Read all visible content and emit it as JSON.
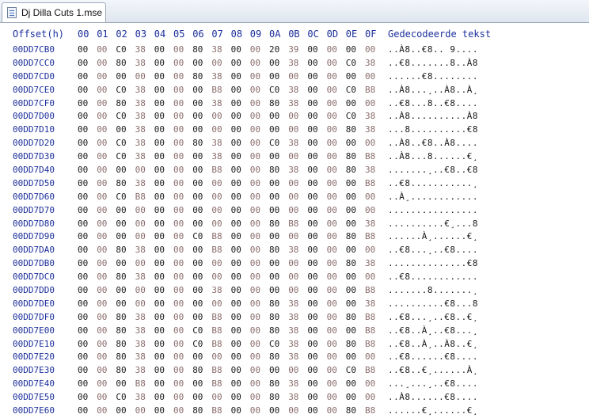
{
  "tab": {
    "title": "Dj Dilla Cuts 1.mse"
  },
  "header": {
    "offset_label": "Offset(h)",
    "columns": [
      "00",
      "01",
      "02",
      "03",
      "04",
      "05",
      "06",
      "07",
      "08",
      "09",
      "0A",
      "0B",
      "0C",
      "0D",
      "0E",
      "0F"
    ],
    "text_label": "Gedecodeerde tekst"
  },
  "rows": [
    {
      "offset": "00DD7CB0",
      "bytes": [
        "00",
        "00",
        "C0",
        "38",
        "00",
        "00",
        "80",
        "38",
        "00",
        "00",
        "20",
        "39",
        "00",
        "00",
        "00",
        "00"
      ],
      "text": "..À8..€8.. 9...."
    },
    {
      "offset": "00DD7CC0",
      "bytes": [
        "00",
        "00",
        "80",
        "38",
        "00",
        "00",
        "00",
        "00",
        "00",
        "00",
        "00",
        "38",
        "00",
        "00",
        "C0",
        "38"
      ],
      "text": "..€8.......8..À8"
    },
    {
      "offset": "00DD7CD0",
      "bytes": [
        "00",
        "00",
        "00",
        "00",
        "00",
        "00",
        "80",
        "38",
        "00",
        "00",
        "00",
        "00",
        "00",
        "00",
        "00",
        "00"
      ],
      "text": "......€8........"
    },
    {
      "offset": "00DD7CE0",
      "bytes": [
        "00",
        "00",
        "C0",
        "38",
        "00",
        "00",
        "00",
        "B8",
        "00",
        "00",
        "C0",
        "38",
        "00",
        "00",
        "C0",
        "B8"
      ],
      "text": "..À8...¸..À8..À¸"
    },
    {
      "offset": "00DD7CF0",
      "bytes": [
        "00",
        "00",
        "80",
        "38",
        "00",
        "00",
        "00",
        "38",
        "00",
        "00",
        "80",
        "38",
        "00",
        "00",
        "00",
        "00"
      ],
      "text": "..€8...8..€8...."
    },
    {
      "offset": "00DD7D00",
      "bytes": [
        "00",
        "00",
        "C0",
        "38",
        "00",
        "00",
        "00",
        "00",
        "00",
        "00",
        "00",
        "00",
        "00",
        "00",
        "C0",
        "38"
      ],
      "text": "..À8..........À8"
    },
    {
      "offset": "00DD7D10",
      "bytes": [
        "00",
        "00",
        "00",
        "38",
        "00",
        "00",
        "00",
        "00",
        "00",
        "00",
        "00",
        "00",
        "00",
        "00",
        "80",
        "38"
      ],
      "text": "...8..........€8"
    },
    {
      "offset": "00DD7D20",
      "bytes": [
        "00",
        "00",
        "C0",
        "38",
        "00",
        "00",
        "80",
        "38",
        "00",
        "00",
        "C0",
        "38",
        "00",
        "00",
        "00",
        "00"
      ],
      "text": "..À8..€8..À8...."
    },
    {
      "offset": "00DD7D30",
      "bytes": [
        "00",
        "00",
        "C0",
        "38",
        "00",
        "00",
        "00",
        "38",
        "00",
        "00",
        "00",
        "00",
        "00",
        "00",
        "80",
        "B8"
      ],
      "text": "..À8...8......€¸"
    },
    {
      "offset": "00DD7D40",
      "bytes": [
        "00",
        "00",
        "00",
        "00",
        "00",
        "00",
        "00",
        "B8",
        "00",
        "00",
        "80",
        "38",
        "00",
        "00",
        "80",
        "38"
      ],
      "text": ".......¸..€8..€8"
    },
    {
      "offset": "00DD7D50",
      "bytes": [
        "00",
        "00",
        "80",
        "38",
        "00",
        "00",
        "00",
        "00",
        "00",
        "00",
        "00",
        "00",
        "00",
        "00",
        "00",
        "B8"
      ],
      "text": "..€8...........¸"
    },
    {
      "offset": "00DD7D60",
      "bytes": [
        "00",
        "00",
        "C0",
        "B8",
        "00",
        "00",
        "00",
        "00",
        "00",
        "00",
        "00",
        "00",
        "00",
        "00",
        "00",
        "00"
      ],
      "text": "..À¸............"
    },
    {
      "offset": "00DD7D70",
      "bytes": [
        "00",
        "00",
        "00",
        "00",
        "00",
        "00",
        "00",
        "00",
        "00",
        "00",
        "00",
        "00",
        "00",
        "00",
        "00",
        "00"
      ],
      "text": "................"
    },
    {
      "offset": "00DD7D80",
      "bytes": [
        "00",
        "00",
        "00",
        "00",
        "00",
        "00",
        "00",
        "00",
        "00",
        "00",
        "80",
        "B8",
        "00",
        "00",
        "00",
        "38"
      ],
      "text": "..........€¸...8"
    },
    {
      "offset": "00DD7D90",
      "bytes": [
        "00",
        "00",
        "00",
        "00",
        "00",
        "00",
        "C0",
        "B8",
        "00",
        "00",
        "00",
        "00",
        "00",
        "00",
        "80",
        "B8"
      ],
      "text": "......À¸......€¸"
    },
    {
      "offset": "00DD7DA0",
      "bytes": [
        "00",
        "00",
        "80",
        "38",
        "00",
        "00",
        "00",
        "B8",
        "00",
        "00",
        "80",
        "38",
        "00",
        "00",
        "00",
        "00"
      ],
      "text": "..€8...¸..€8...."
    },
    {
      "offset": "00DD7DB0",
      "bytes": [
        "00",
        "00",
        "00",
        "00",
        "00",
        "00",
        "00",
        "00",
        "00",
        "00",
        "00",
        "00",
        "00",
        "00",
        "80",
        "38"
      ],
      "text": "..............€8"
    },
    {
      "offset": "00DD7DC0",
      "bytes": [
        "00",
        "00",
        "80",
        "38",
        "00",
        "00",
        "00",
        "00",
        "00",
        "00",
        "00",
        "00",
        "00",
        "00",
        "00",
        "00"
      ],
      "text": "..€8............"
    },
    {
      "offset": "00DD7DD0",
      "bytes": [
        "00",
        "00",
        "00",
        "00",
        "00",
        "00",
        "00",
        "38",
        "00",
        "00",
        "00",
        "00",
        "00",
        "00",
        "00",
        "B8"
      ],
      "text": ".......8.......¸"
    },
    {
      "offset": "00DD7DE0",
      "bytes": [
        "00",
        "00",
        "00",
        "00",
        "00",
        "00",
        "00",
        "00",
        "00",
        "00",
        "80",
        "38",
        "00",
        "00",
        "00",
        "38"
      ],
      "text": "..........€8...8"
    },
    {
      "offset": "00DD7DF0",
      "bytes": [
        "00",
        "00",
        "80",
        "38",
        "00",
        "00",
        "00",
        "B8",
        "00",
        "00",
        "80",
        "38",
        "00",
        "00",
        "80",
        "B8"
      ],
      "text": "..€8...¸..€8..€¸"
    },
    {
      "offset": "00DD7E00",
      "bytes": [
        "00",
        "00",
        "80",
        "38",
        "00",
        "00",
        "C0",
        "B8",
        "00",
        "00",
        "80",
        "38",
        "00",
        "00",
        "00",
        "B8"
      ],
      "text": "..€8..À¸..€8...¸"
    },
    {
      "offset": "00DD7E10",
      "bytes": [
        "00",
        "00",
        "80",
        "38",
        "00",
        "00",
        "C0",
        "B8",
        "00",
        "00",
        "C0",
        "38",
        "00",
        "00",
        "80",
        "B8"
      ],
      "text": "..€8..À¸..À8..€¸"
    },
    {
      "offset": "00DD7E20",
      "bytes": [
        "00",
        "00",
        "80",
        "38",
        "00",
        "00",
        "00",
        "00",
        "00",
        "00",
        "80",
        "38",
        "00",
        "00",
        "00",
        "00"
      ],
      "text": "..€8......€8...."
    },
    {
      "offset": "00DD7E30",
      "bytes": [
        "00",
        "00",
        "80",
        "38",
        "00",
        "00",
        "80",
        "B8",
        "00",
        "00",
        "00",
        "00",
        "00",
        "00",
        "C0",
        "B8"
      ],
      "text": "..€8..€¸......À¸"
    },
    {
      "offset": "00DD7E40",
      "bytes": [
        "00",
        "00",
        "00",
        "B8",
        "00",
        "00",
        "00",
        "B8",
        "00",
        "00",
        "80",
        "38",
        "00",
        "00",
        "00",
        "00"
      ],
      "text": "...¸...¸..€8...."
    },
    {
      "offset": "00DD7E50",
      "bytes": [
        "00",
        "00",
        "C0",
        "38",
        "00",
        "00",
        "00",
        "00",
        "00",
        "00",
        "80",
        "38",
        "00",
        "00",
        "00",
        "00"
      ],
      "text": "..À8......€8...."
    },
    {
      "offset": "00DD7E60",
      "bytes": [
        "00",
        "00",
        "00",
        "00",
        "00",
        "00",
        "80",
        "B8",
        "00",
        "00",
        "00",
        "00",
        "00",
        "00",
        "80",
        "B8"
      ],
      "text": "......€¸......€¸"
    }
  ],
  "colors": {
    "offset": "#1c2f9c",
    "byte": "#1a1a1a",
    "byte_zero_odd": "#8a6c6c"
  }
}
